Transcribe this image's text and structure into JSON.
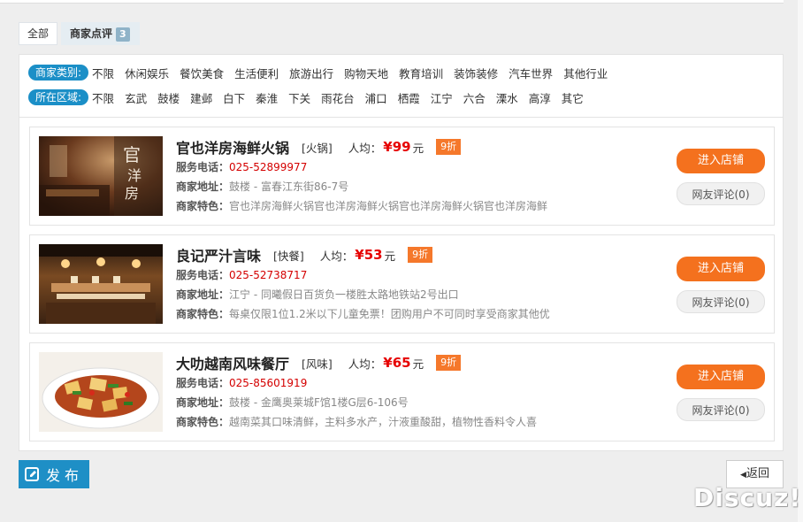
{
  "tabs": [
    {
      "label": "全部"
    },
    {
      "label": "商家点评",
      "count": "3"
    }
  ],
  "filters": {
    "category_label": "商家类别:",
    "categories": [
      "不限",
      "休闲娱乐",
      "餐饮美食",
      "生活便利",
      "旅游出行",
      "购物天地",
      "教育培训",
      "装饰装修",
      "汽车世界",
      "其他行业"
    ],
    "area_label": "所在区域:",
    "areas": [
      "不限",
      "玄武",
      "鼓楼",
      "建邺",
      "白下",
      "秦淮",
      "下关",
      "雨花台",
      "浦口",
      "栖霞",
      "江宁",
      "六合",
      "溧水",
      "高淳",
      "其它"
    ]
  },
  "labels": {
    "avg": "人均：",
    "currency": "¥",
    "yuan": "元",
    "phone": "服务电话：",
    "address": "商家地址：",
    "feature": "商家特色："
  },
  "shops": [
    {
      "name": "官也洋房海鲜火锅",
      "category": "[火锅]",
      "price": "99",
      "discount": "9折",
      "phone": "025-52899977",
      "address": "鼓楼 - 富春江东街86-7号",
      "feature": "官也洋房海鲜火锅官也洋房海鲜火锅官也洋房海鲜火锅官也洋房海鲜",
      "enter": "进入店铺",
      "review": "网友评论(0)"
    },
    {
      "name": "良记严汁言味",
      "category": "[快餐]",
      "price": "53",
      "discount": "9折",
      "phone": "025-52738717",
      "address": "江宁 - 同曦假日百货负一楼胜太路地铁站2号出口",
      "feature": "每桌仅限1位1.2米以下儿童免票！团购用户不可同时享受商家其他优",
      "enter": "进入店铺",
      "review": "网友评论(0)"
    },
    {
      "name": "大叻越南风味餐厅",
      "category": "[风味]",
      "price": "65",
      "discount": "9折",
      "phone": "025-85601919",
      "address": "鼓楼 - 金鹰奥莱城F馆1楼G层6-106号",
      "feature": "越南菜其口味清鲜，主料多水产，汁液重酸甜，植物性香料令人喜",
      "enter": "进入店铺",
      "review": "网友评论(0)"
    }
  ],
  "footer": {
    "publish": "发布",
    "back": "返回"
  },
  "watermark": "Discuz!"
}
